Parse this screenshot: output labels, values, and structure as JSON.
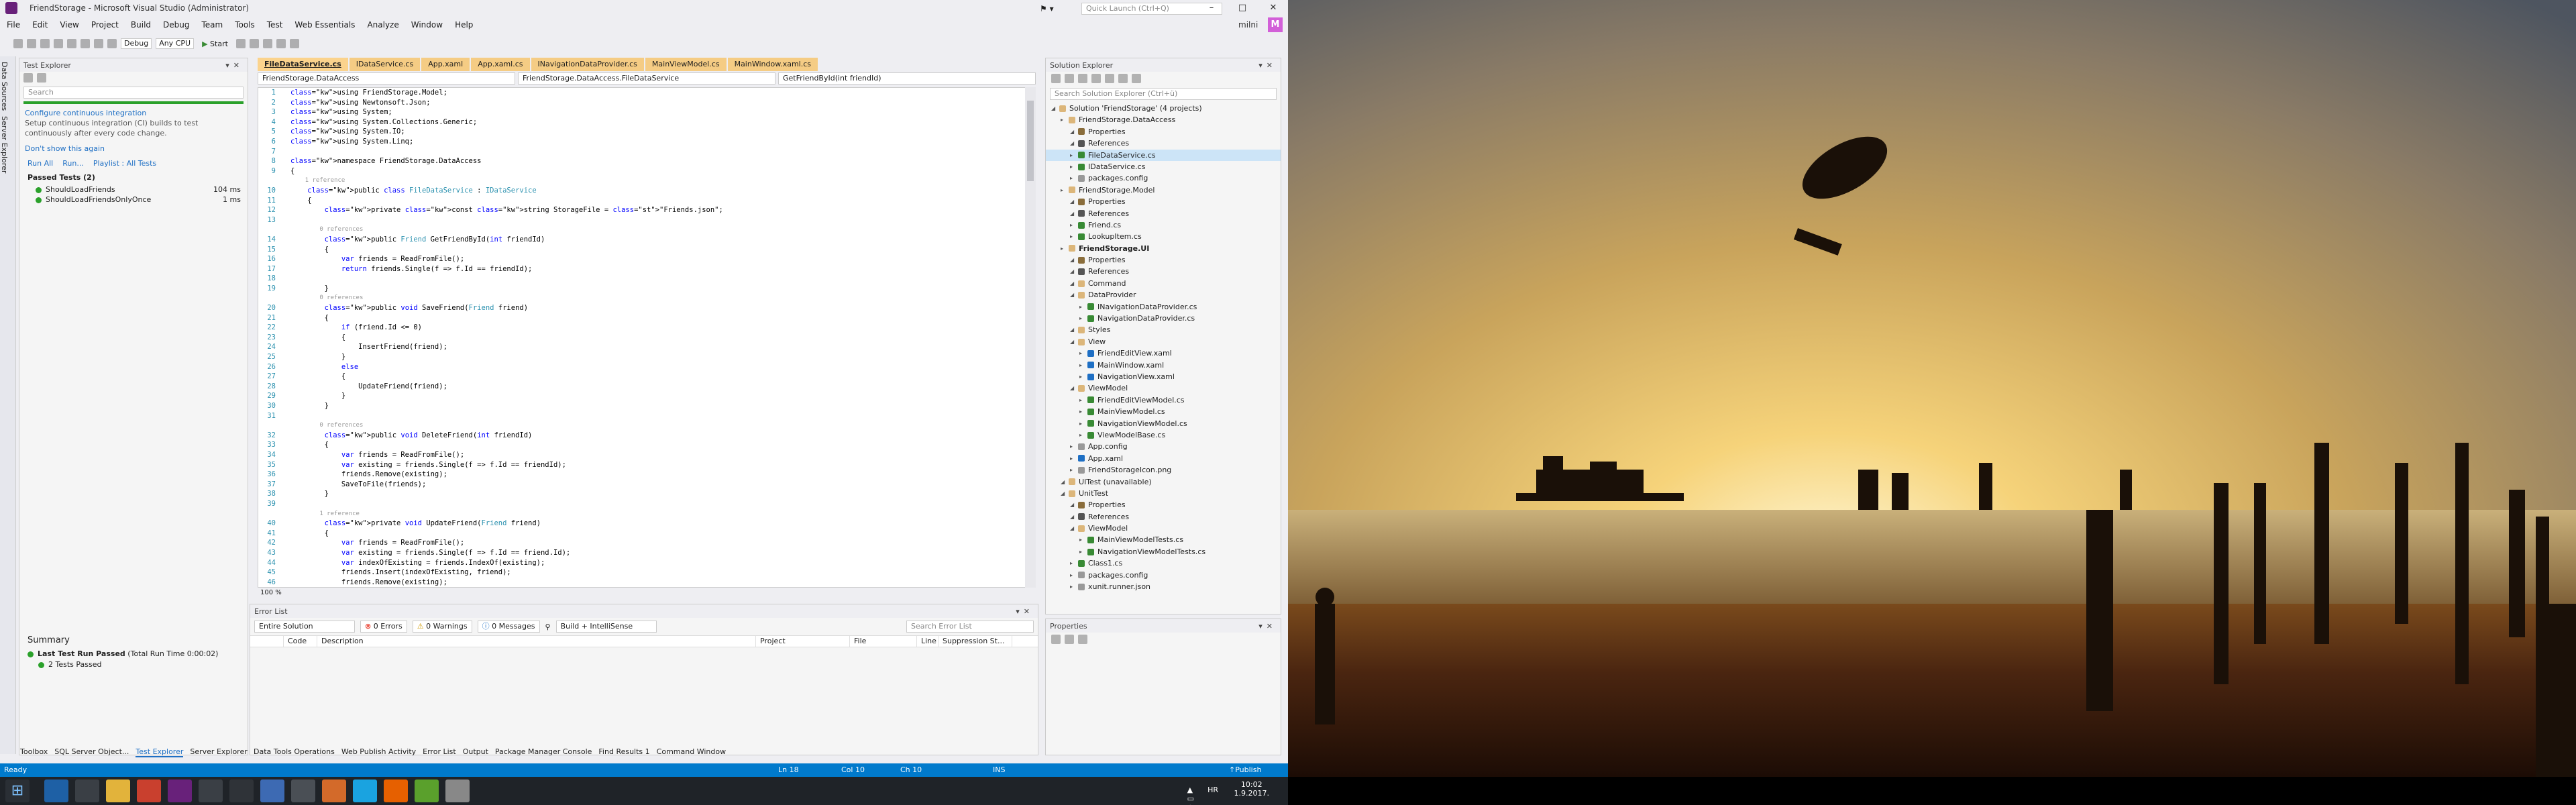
{
  "window": {
    "title": "FriendStorage - Microsoft Visual Studio (Administrator)",
    "quick_launch": "Quick Launch (Ctrl+Q)",
    "user": "milni",
    "avatar": "M"
  },
  "menu": [
    "File",
    "Edit",
    "View",
    "Project",
    "Build",
    "Debug",
    "Team",
    "Tools",
    "Test",
    "Web Essentials",
    "Analyze",
    "Window",
    "Help"
  ],
  "toolbar": {
    "config": "Debug",
    "platform": "Any CPU",
    "start": "Start"
  },
  "side_strip": [
    "Data Sources",
    "Server Explorer"
  ],
  "test_explorer": {
    "title": "Test Explorer",
    "search": "Search",
    "ci_link": "Configure continuous integration",
    "ci_text": "Setup continuous integration (CI) builds to test continuously after every code change.",
    "dont_show": "Don't show this again",
    "run_all": "Run All",
    "run": "Run...",
    "playlist": "Playlist : All Tests",
    "group": "Passed Tests (2)",
    "tests": [
      {
        "name": "ShouldLoadFriends",
        "time": "104 ms"
      },
      {
        "name": "ShouldLoadFriendsOnlyOnce",
        "time": "1 ms"
      }
    ],
    "summary_title": "Summary",
    "last_run": "Last Test Run Passed",
    "last_run_time": "(Total Run Time 0:00:02)",
    "passed": "2 Tests Passed"
  },
  "editor_tabs": [
    "FileDataService.cs",
    "IDataService.cs",
    "App.xaml",
    "App.xaml.cs",
    "INavigationDataProvider.cs",
    "MainViewModel.cs",
    "MainWindow.xaml.cs"
  ],
  "navbar": {
    "project": "FriendStorage.DataAccess",
    "class": "FriendStorage.DataAccess.FileDataService",
    "member": "GetFriendById(int friendId)"
  },
  "code": [
    {
      "n": "1",
      "t": "using FriendStorage.Model;"
    },
    {
      "n": "2",
      "t": "using Newtonsoft.Json;"
    },
    {
      "n": "3",
      "t": "using System;"
    },
    {
      "n": "4",
      "t": "using System.Collections.Generic;"
    },
    {
      "n": "5",
      "t": "using System.IO;"
    },
    {
      "n": "6",
      "t": "using System.Linq;"
    },
    {
      "n": "7",
      "t": ""
    },
    {
      "n": "8",
      "t": "namespace FriendStorage.DataAccess"
    },
    {
      "n": "9",
      "t": "{"
    },
    {
      "n": "",
      "t": "    1 reference",
      "r": true
    },
    {
      "n": "10",
      "t": "    public class FileDataService : IDataService"
    },
    {
      "n": "11",
      "t": "    {"
    },
    {
      "n": "12",
      "t": "        private const string StorageFile = \"Friends.json\";"
    },
    {
      "n": "13",
      "t": ""
    },
    {
      "n": "",
      "t": "        0 references",
      "r": true
    },
    {
      "n": "14",
      "t": "        public Friend GetFriendById(int friendId)"
    },
    {
      "n": "15",
      "t": "        {"
    },
    {
      "n": "16",
      "t": "            var friends = ReadFromFile();"
    },
    {
      "n": "17",
      "t": "            return friends.Single(f => f.Id == friendId);"
    },
    {
      "n": "18",
      "t": ""
    },
    {
      "n": "19",
      "t": "        }"
    },
    {
      "n": "",
      "t": "        0 references",
      "r": true
    },
    {
      "n": "20",
      "t": "        public void SaveFriend(Friend friend)"
    },
    {
      "n": "21",
      "t": "        {"
    },
    {
      "n": "22",
      "t": "            if (friend.Id <= 0)"
    },
    {
      "n": "23",
      "t": "            {"
    },
    {
      "n": "24",
      "t": "                InsertFriend(friend);"
    },
    {
      "n": "25",
      "t": "            }"
    },
    {
      "n": "26",
      "t": "            else"
    },
    {
      "n": "27",
      "t": "            {"
    },
    {
      "n": "28",
      "t": "                UpdateFriend(friend);"
    },
    {
      "n": "29",
      "t": "            }"
    },
    {
      "n": "30",
      "t": "        }"
    },
    {
      "n": "31",
      "t": ""
    },
    {
      "n": "",
      "t": "        0 references",
      "r": true
    },
    {
      "n": "32",
      "t": "        public void DeleteFriend(int friendId)"
    },
    {
      "n": "33",
      "t": "        {"
    },
    {
      "n": "34",
      "t": "            var friends = ReadFromFile();"
    },
    {
      "n": "35",
      "t": "            var existing = friends.Single(f => f.Id == friendId);"
    },
    {
      "n": "36",
      "t": "            friends.Remove(existing);"
    },
    {
      "n": "37",
      "t": "            SaveToFile(friends);"
    },
    {
      "n": "38",
      "t": "        }"
    },
    {
      "n": "39",
      "t": ""
    },
    {
      "n": "",
      "t": "        1 reference",
      "r": true
    },
    {
      "n": "40",
      "t": "        private void UpdateFriend(Friend friend)"
    },
    {
      "n": "41",
      "t": "        {"
    },
    {
      "n": "42",
      "t": "            var friends = ReadFromFile();"
    },
    {
      "n": "43",
      "t": "            var existing = friends.Single(f => f.Id == friend.Id);"
    },
    {
      "n": "44",
      "t": "            var indexOfExisting = friends.IndexOf(existing);"
    },
    {
      "n": "45",
      "t": "            friends.Insert(indexOfExisting, friend);"
    },
    {
      "n": "46",
      "t": "            friends.Remove(existing);"
    }
  ],
  "zoom": "100 %",
  "error_list": {
    "title": "Error List",
    "scope": "Entire Solution",
    "errors": "0 Errors",
    "warnings": "0 Warnings",
    "messages": "0 Messages",
    "build": "Build + IntelliSense",
    "search": "Search Error List",
    "cols": [
      "Code",
      "Description",
      "Project",
      "File",
      "Line",
      "Suppression St..."
    ]
  },
  "bottom_tabs_left": [
    "Toolbox",
    "SQL Server Object...",
    "Test Explorer",
    "Server Explorer"
  ],
  "bottom_tabs_right": [
    "Data Tools Operations",
    "Web Publish Activity",
    "Error List",
    "Output",
    "Package Manager Console",
    "Find Results 1",
    "Command Window"
  ],
  "solution_explorer": {
    "title": "Solution Explorer",
    "search": "Search Solution Explorer (Ctrl+ü)",
    "items": [
      {
        "d": 0,
        "t": "Solution 'FriendStorage' (4 projects)"
      },
      {
        "d": 1,
        "t": "FriendStorage.DataAccess"
      },
      {
        "d": 2,
        "t": "Properties"
      },
      {
        "d": 2,
        "t": "References"
      },
      {
        "d": 2,
        "t": "FileDataService.cs",
        "s": true
      },
      {
        "d": 2,
        "t": "IDataService.cs"
      },
      {
        "d": 2,
        "t": "packages.config"
      },
      {
        "d": 1,
        "t": "FriendStorage.Model"
      },
      {
        "d": 2,
        "t": "Properties"
      },
      {
        "d": 2,
        "t": "References"
      },
      {
        "d": 2,
        "t": "Friend.cs"
      },
      {
        "d": 2,
        "t": "LookupItem.cs"
      },
      {
        "d": 1,
        "t": "FriendStorage.UI"
      },
      {
        "d": 2,
        "t": "Properties"
      },
      {
        "d": 2,
        "t": "References"
      },
      {
        "d": 2,
        "t": "Command"
      },
      {
        "d": 2,
        "t": "DataProvider"
      },
      {
        "d": 3,
        "t": "INavigationDataProvider.cs"
      },
      {
        "d": 3,
        "t": "NavigationDataProvider.cs"
      },
      {
        "d": 2,
        "t": "Styles"
      },
      {
        "d": 2,
        "t": "View"
      },
      {
        "d": 3,
        "t": "FriendEditView.xaml"
      },
      {
        "d": 3,
        "t": "MainWindow.xaml"
      },
      {
        "d": 3,
        "t": "NavigationView.xaml"
      },
      {
        "d": 2,
        "t": "ViewModel"
      },
      {
        "d": 3,
        "t": "FriendEditViewModel.cs"
      },
      {
        "d": 3,
        "t": "MainViewModel.cs"
      },
      {
        "d": 3,
        "t": "NavigationViewModel.cs"
      },
      {
        "d": 3,
        "t": "ViewModelBase.cs"
      },
      {
        "d": 2,
        "t": "App.config"
      },
      {
        "d": 2,
        "t": "App.xaml"
      },
      {
        "d": 2,
        "t": "FriendStorageIcon.png"
      },
      {
        "d": 1,
        "t": "UITest (unavailable)"
      },
      {
        "d": 1,
        "t": "UnitTest"
      },
      {
        "d": 2,
        "t": "Properties"
      },
      {
        "d": 2,
        "t": "References"
      },
      {
        "d": 2,
        "t": "ViewModel"
      },
      {
        "d": 3,
        "t": "MainViewModelTests.cs"
      },
      {
        "d": 3,
        "t": "NavigationViewModelTests.cs"
      },
      {
        "d": 2,
        "t": "Class1.cs"
      },
      {
        "d": 2,
        "t": "packages.config"
      },
      {
        "d": 2,
        "t": "xunit.runner.json"
      }
    ]
  },
  "properties": {
    "title": "Properties"
  },
  "status": {
    "ready": "Ready",
    "ln": "Ln 18",
    "col": "Col 10",
    "ch": "Ch 10",
    "ins": "INS",
    "publish": "Publish"
  },
  "tray": {
    "lang": "HR",
    "time": "10:02",
    "date": "1.9.2017."
  },
  "colors": {
    "accent": "#007acc",
    "tab": "#f5cc84",
    "pass": "#2ba12b",
    "vs_purple": "#68217a"
  }
}
